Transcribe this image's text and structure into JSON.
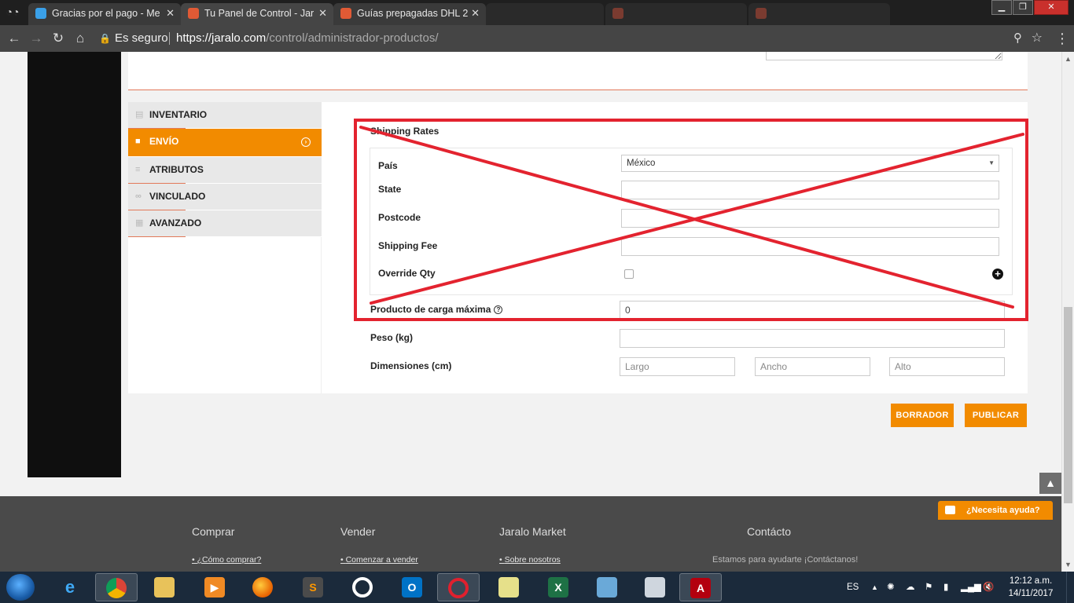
{
  "browser": {
    "tabs": [
      {
        "title": "Gracias por el pago - Me",
        "active": false,
        "dim": false
      },
      {
        "title": "Tu Panel de Control - Jar",
        "active": true,
        "dim": false
      },
      {
        "title": "Guías prepagadas DHL 2",
        "active": false,
        "dim": false
      },
      {
        "title": "",
        "active": false,
        "dim": true
      },
      {
        "title": "",
        "active": false,
        "dim": true
      },
      {
        "title": "",
        "active": false,
        "dim": true
      }
    ],
    "security_label": "Es seguro",
    "url_host": "https://jaralo.com",
    "url_path": "/control/administrador-productos/"
  },
  "sidebar_tabs": [
    {
      "label": "INVENTARIO",
      "icon": "database-icon",
      "active": false
    },
    {
      "label": "ENVÍO",
      "icon": "truck-icon",
      "active": true
    },
    {
      "label": "ATRIBUTOS",
      "icon": "list-icon",
      "active": false
    },
    {
      "label": "VINCULADO",
      "icon": "link-icon",
      "active": false
    },
    {
      "label": "AVANZADO",
      "icon": "grid-icon",
      "active": false
    }
  ],
  "shipping": {
    "section_title": "Shipping Rates",
    "pais_label": "País",
    "pais_value": "México",
    "state_label": "State",
    "postcode_label": "Postcode",
    "fee_label": "Shipping Fee",
    "override_label": "Override Qty",
    "max_load_label": "Producto de carga máxima",
    "max_load_value": "0",
    "peso_label": "Peso (kg)",
    "dim_label": "Dimensiones (cm)",
    "largo_placeholder": "Largo",
    "ancho_placeholder": "Ancho",
    "alto_placeholder": "Alto"
  },
  "buttons": {
    "draft": "BORRADOR",
    "publish": "PUBLICAR"
  },
  "footer": {
    "col1_title": "Comprar",
    "col1_link": "¿Cómo comprar?",
    "col2_title": "Vender",
    "col2_link": "Comenzar a vender",
    "col3_title": "Jaralo Market",
    "col3_link": "Sobre nosotros",
    "col4_title": "Contácto",
    "col4_text": "Estamos para ayudarte ¡Contáctanos!",
    "help_chat": "¿Necesita ayuda?"
  },
  "taskbar": {
    "lang": "ES",
    "time": "12:12 a.m.",
    "date": "14/11/2017"
  },
  "colors": {
    "accent_orange": "#f28b00",
    "annotation_red": "#e3232f"
  }
}
